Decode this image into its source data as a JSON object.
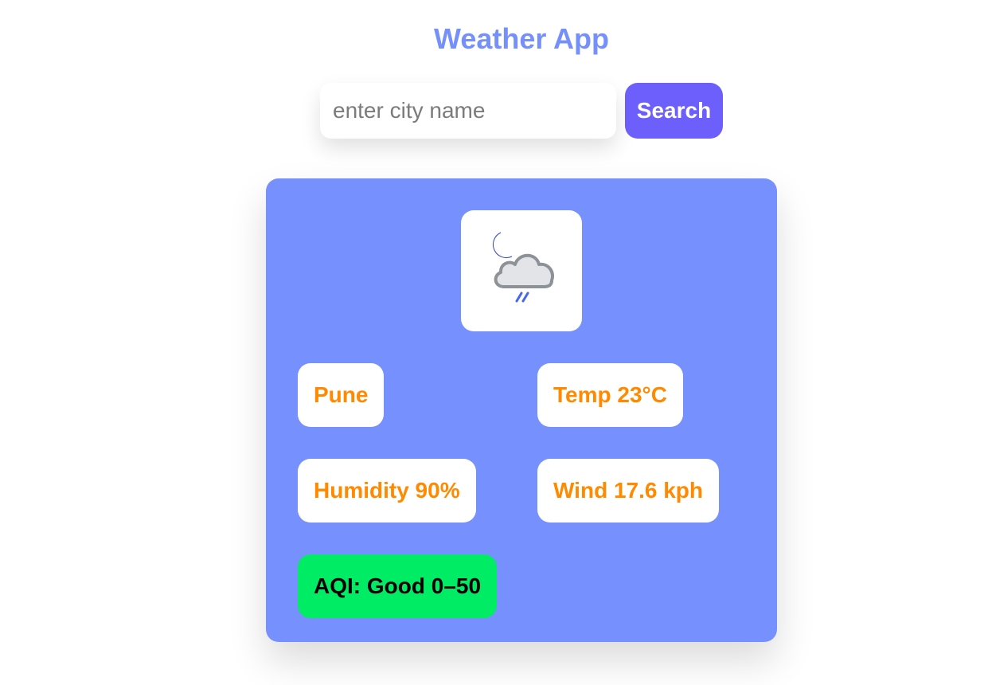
{
  "app": {
    "title": "Weather App"
  },
  "search": {
    "placeholder": "enter city name",
    "value": "",
    "button_label": "Search"
  },
  "weather": {
    "icon": "night-cloud-rain-icon",
    "city": "Pune",
    "temperature": "Temp 23°C",
    "humidity": "Humidity 90%",
    "wind": "Wind 17.6 kph",
    "aqi": "AQI: Good 0–50"
  },
  "colors": {
    "title": "#7690fb",
    "button": "#6c5ffc",
    "card": "#7690fd",
    "value_text": "#ff8a00",
    "aqi_good": "#00ec64"
  }
}
